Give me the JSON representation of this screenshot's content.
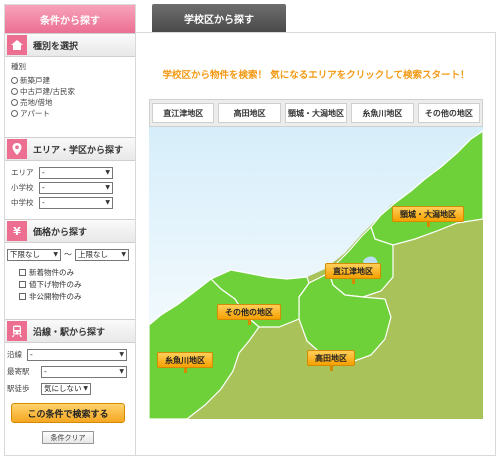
{
  "sidebar": {
    "tab_label": "条件から探す",
    "type_section": {
      "title": "種別を選択",
      "label": "種別",
      "options": [
        "新築戸建",
        "中古戸建/古民家",
        "売地/借地",
        "アパート"
      ]
    },
    "area_section": {
      "title": "エリア・学区から探す",
      "area_label": "エリア",
      "area_value": "-",
      "elementary_label": "小学校",
      "elementary_value": "-",
      "junior_label": "中学校",
      "junior_value": "-"
    },
    "price_section": {
      "title": "価格から探す",
      "min_value": "下限なし",
      "separator": "～",
      "max_value": "上限なし",
      "checks": [
        "新着物件のみ",
        "値下げ物件のみ",
        "非公開物件のみ"
      ]
    },
    "line_section": {
      "title": "沿線・駅から探す",
      "line_label": "沿線",
      "line_value": "-",
      "station_label": "最寄駅",
      "station_value": "-",
      "walk_label": "駅徒歩",
      "walk_value": "気にしない"
    },
    "search_button": "この条件で検索する",
    "clear_button": "条件クリア"
  },
  "main": {
    "tab_label": "学校区から探す",
    "headline": "学校区から物件を検索！ 気になるエリアをクリックして検索スタート！",
    "area_tabs": [
      "直江津地区",
      "高田地区",
      "頸城・大潟地区",
      "糸魚川地区",
      "その他の地区"
    ],
    "map_labels": {
      "kubiki": "頸城・大潟地区",
      "naoetsu": "直江津地区",
      "sonota": "その他の地区",
      "itoigawa": "糸魚川地区",
      "takada": "高田地区"
    }
  },
  "colors": {
    "pink_accent": "#ec6f92",
    "orange_headline": "#f39a14",
    "sea": "#b9dff2",
    "land_light": "#6fd13a",
    "land_olive": "#a9c25a"
  }
}
